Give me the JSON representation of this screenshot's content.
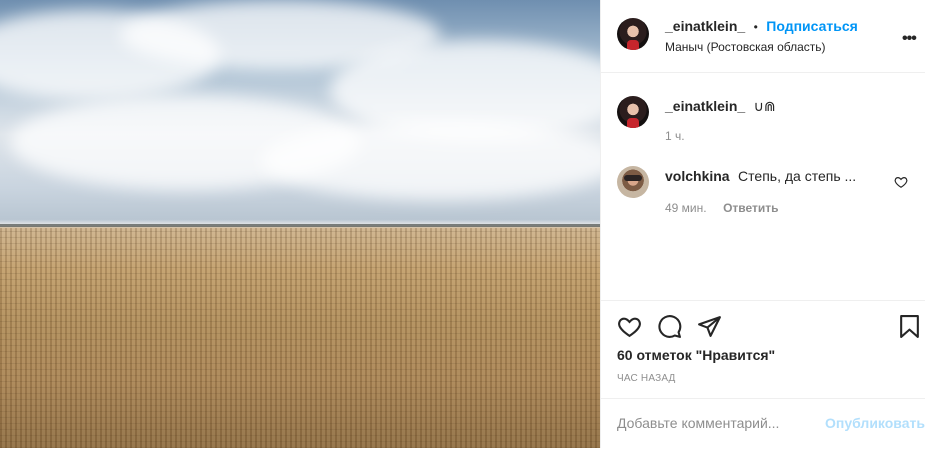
{
  "post": {
    "author": "_einatklein_",
    "separator": "•",
    "follow_label": "Подписаться",
    "location": "Маныч (Ростовская область)",
    "more_label": "•••",
    "caption_user": "_einatklein_",
    "caption_text": "∪⋒",
    "caption_time": "1 ч."
  },
  "comments": [
    {
      "user": "volchkina",
      "text": "Степь, да степь ...",
      "time": "49 мин.",
      "reply_label": "Ответить"
    }
  ],
  "actions": {
    "icons": [
      "heart-icon",
      "comment-icon",
      "share-icon",
      "bookmark-icon"
    ],
    "likes_text": "60 отметок \"Нравится\"",
    "posted_ago": "ЧАС НАЗАД"
  },
  "add_comment": {
    "placeholder": "Добавьте комментарий...",
    "publish_label": "Опубликовать"
  },
  "colors": {
    "accent": "#0095f6",
    "publish_disabled": "#b2dffc",
    "muted": "#8e8e8e",
    "text": "#262626"
  }
}
